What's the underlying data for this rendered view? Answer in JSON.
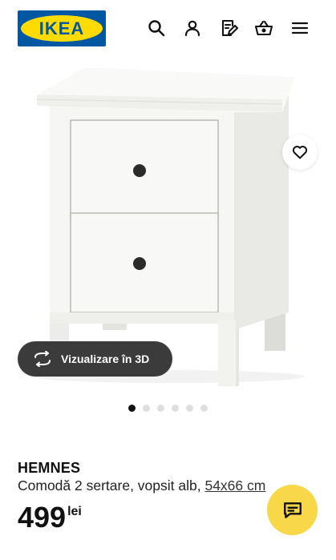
{
  "header": {
    "logo_text": "IKEA",
    "icons": [
      "search-icon",
      "user-icon",
      "shopping-list-icon",
      "basket-icon",
      "menu-icon"
    ]
  },
  "product": {
    "brand": "HEMNES",
    "description": "Comodă 2 sertare, vopsit alb,",
    "dimensions": "54x66 cm",
    "price": "499",
    "currency": "lei",
    "image_count": 6,
    "active_image": 1
  },
  "buttons": {
    "view_3d": "Vizualizare în 3D"
  },
  "colors": {
    "ikea_blue": "#0058a3",
    "ikea_yellow": "#ffdb00",
    "chat_button": "#f8d848",
    "dark_pill": "#3b3b3b"
  }
}
